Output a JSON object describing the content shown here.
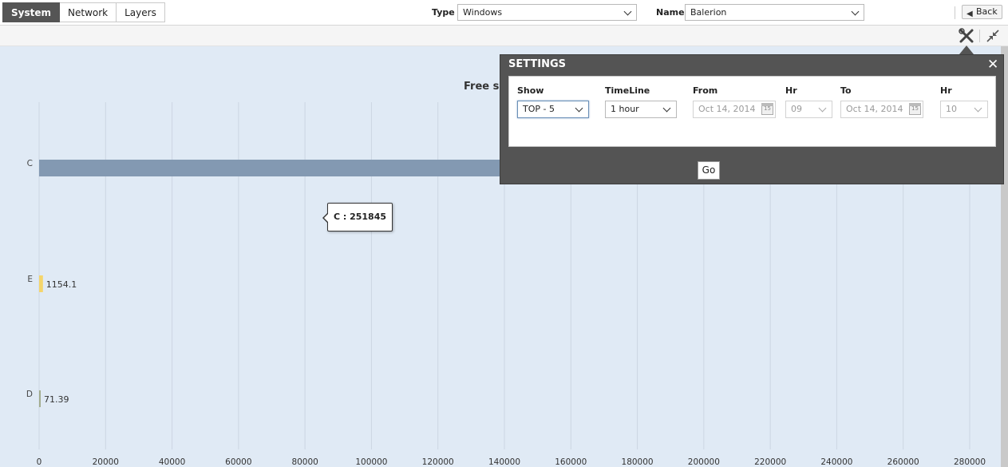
{
  "tabs": [
    {
      "label": "System",
      "active": true
    },
    {
      "label": "Network",
      "active": false
    },
    {
      "label": "Layers",
      "active": false
    }
  ],
  "filters": {
    "type_label": "Type",
    "type_value": "Windows",
    "name_label": "Name",
    "name_value": "Balerion"
  },
  "toolbar": {
    "back_label": "Back",
    "settings_icon": "tools-icon",
    "collapse_icon": "collapse-arrows-icon"
  },
  "settings": {
    "title": "SETTINGS",
    "show_label": "Show",
    "show_value": "TOP - 5",
    "timeline_label": "TimeLine",
    "timeline_value": "1 hour",
    "from_label": "From",
    "from_value": "Oct 14, 2014",
    "from_hr_label": "Hr",
    "from_hr_value": "09",
    "to_label": "To",
    "to_value": "Oct 14, 2014",
    "to_hr_label": "Hr",
    "to_hr_value": "10",
    "calendar_glyph": "15",
    "go_label": "Go"
  },
  "tooltip": "C : 251845",
  "colors": {
    "accent_tab": "#555555",
    "plot_bg": "#e0eaf5",
    "bar_c": "#8399b2",
    "bar_e": "#f5d56b",
    "bar_d": "#a3ad8f"
  },
  "chart_data": {
    "type": "bar",
    "orientation": "horizontal",
    "title": "Free sp",
    "categories": [
      "C",
      "E",
      "D"
    ],
    "values": [
      251845,
      1154.1,
      71.39
    ],
    "data_labels": [
      "",
      "1154.1",
      "71.39"
    ],
    "xlim": [
      0,
      280000
    ],
    "x_ticks": [
      0,
      20000,
      40000,
      60000,
      80000,
      100000,
      120000,
      140000,
      160000,
      180000,
      200000,
      220000,
      240000,
      260000,
      280000
    ],
    "grid": true
  }
}
